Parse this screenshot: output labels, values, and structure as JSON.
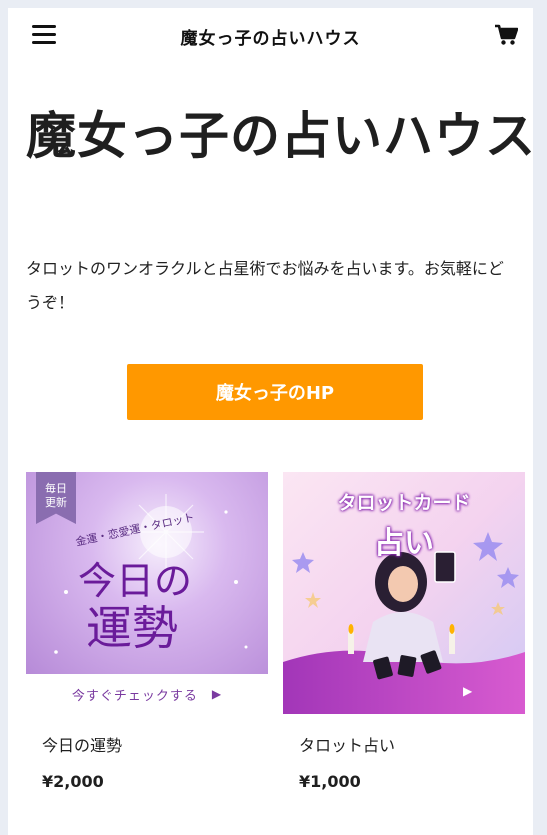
{
  "header": {
    "title": "魔女っ子の占いハウス",
    "menu_icon": "hamburger-menu-icon",
    "cart_icon": "shopping-cart-icon"
  },
  "hero": {
    "title": "魔女っ子の占いハウス",
    "intro": "タロットのワンオラクルと占星術でお悩みを占います。お気軽にどうぞ！",
    "cta_label": "魔女っ子のHP"
  },
  "products": [
    {
      "name": "今日の運勢",
      "price": "¥2,000",
      "image": {
        "badge": "毎日\n更新",
        "subtitle": "金運・恋愛運・タロット",
        "main_line1": "今日の",
        "main_line2": "運勢",
        "footer": "今すぐチェックする",
        "play_icon": "▶"
      }
    },
    {
      "name": "タロット占い",
      "price": "¥1,000",
      "image": {
        "title_line1": "タロットカード",
        "title_line2": "占い",
        "play_icon": "▶"
      }
    }
  ],
  "colors": {
    "cta": "#ff9800",
    "page_background": "#e9edf4",
    "text": "#1f1f1f",
    "accent_purple": "#6a1b9a"
  }
}
